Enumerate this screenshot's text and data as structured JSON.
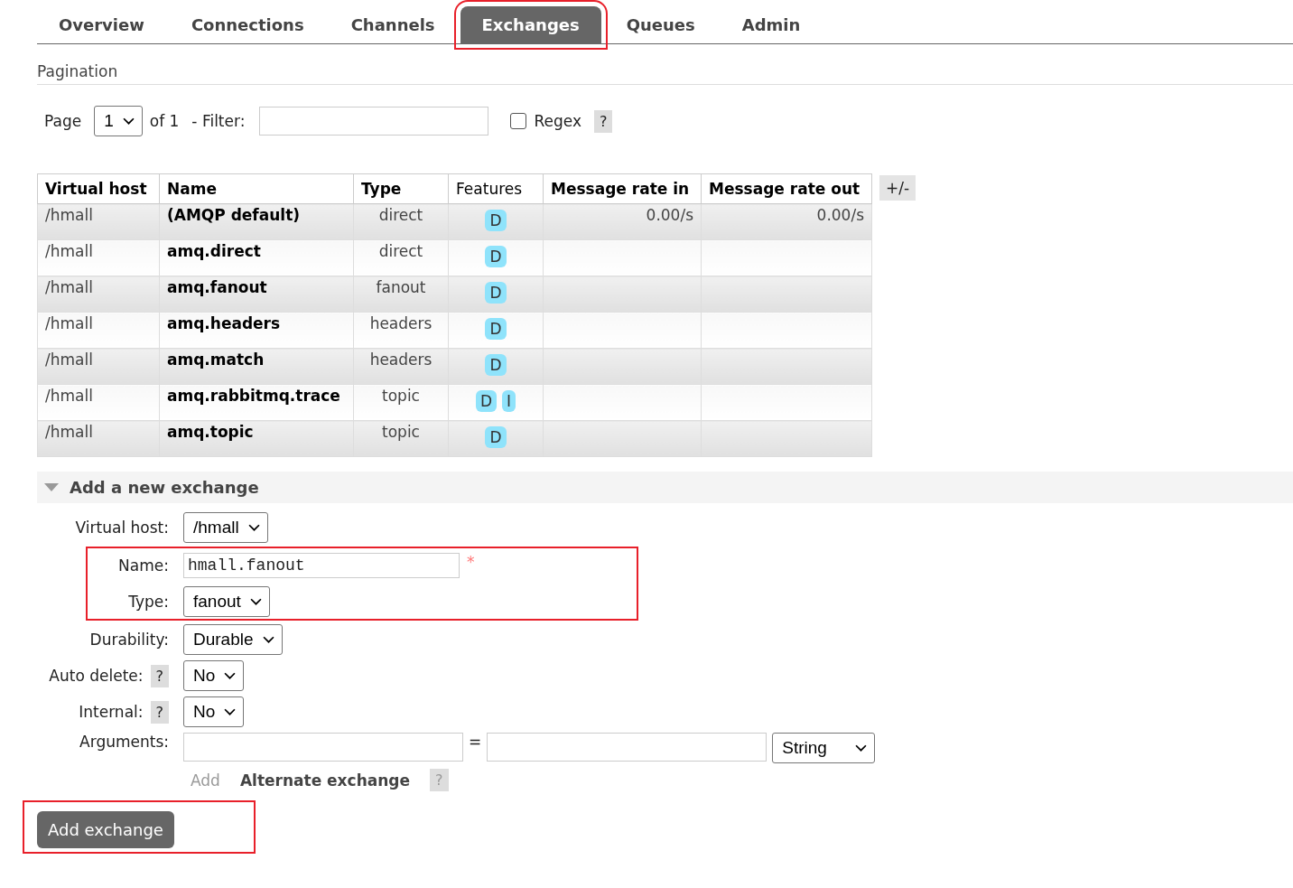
{
  "tabs": [
    {
      "label": "Overview",
      "selected": false,
      "highlighted": false
    },
    {
      "label": "Connections",
      "selected": false,
      "highlighted": false
    },
    {
      "label": "Channels",
      "selected": false,
      "highlighted": false
    },
    {
      "label": "Exchanges",
      "selected": true,
      "highlighted": true
    },
    {
      "label": "Queues",
      "selected": false,
      "highlighted": false
    },
    {
      "label": "Admin",
      "selected": false,
      "highlighted": false
    }
  ],
  "pagination": {
    "title": "Pagination",
    "page_label": "Page",
    "page_value": "1",
    "of_label": "of 1",
    "filter_label": "- Filter:",
    "regex_checked": false,
    "regex_label": "Regex",
    "help": "?"
  },
  "table": {
    "columns": [
      {
        "label": "Virtual host",
        "bold": true
      },
      {
        "label": "Name",
        "bold": true
      },
      {
        "label": "Type",
        "bold": true
      },
      {
        "label": "Features",
        "bold": false
      },
      {
        "label": "Message rate in",
        "bold": true
      },
      {
        "label": "Message rate out",
        "bold": true
      }
    ],
    "toggle": "+/-",
    "rows": [
      {
        "vhost": "/hmall",
        "name": "(AMQP default)",
        "type": "direct",
        "features": [
          "D"
        ],
        "rate_in": "0.00/s",
        "rate_out": "0.00/s"
      },
      {
        "vhost": "/hmall",
        "name": "amq.direct",
        "type": "direct",
        "features": [
          "D"
        ]
      },
      {
        "vhost": "/hmall",
        "name": "amq.fanout",
        "type": "fanout",
        "features": [
          "D"
        ]
      },
      {
        "vhost": "/hmall",
        "name": "amq.headers",
        "type": "headers",
        "features": [
          "D"
        ]
      },
      {
        "vhost": "/hmall",
        "name": "amq.match",
        "type": "headers",
        "features": [
          "D"
        ]
      },
      {
        "vhost": "/hmall",
        "name": "amq.rabbitmq.trace",
        "type": "topic",
        "features": [
          "D",
          "I"
        ]
      },
      {
        "vhost": "/hmall",
        "name": "amq.topic",
        "type": "topic",
        "features": [
          "D"
        ]
      }
    ]
  },
  "add_exchange": {
    "title": "Add a new exchange",
    "expanded": true,
    "groups": [
      {
        "fields": [
          {
            "kind": "select",
            "label": "Virtual host:",
            "value": "/hmall"
          }
        ]
      },
      {
        "highlighted": true,
        "fields": [
          {
            "kind": "text",
            "label": "Name:",
            "value": "hmall.fanout",
            "required": "*"
          },
          {
            "kind": "select",
            "label": "Type:",
            "value": "fanout"
          }
        ]
      },
      {
        "fields": [
          {
            "kind": "select",
            "label": "Durability:",
            "value": "Durable"
          },
          {
            "kind": "select",
            "label": "Auto delete:",
            "help": "?",
            "value": "No"
          },
          {
            "kind": "select",
            "label": "Internal:",
            "help": "?",
            "value": "No"
          },
          {
            "kind": "arguments",
            "label": "Arguments:",
            "equals": "=",
            "arg_type": "String",
            "add_label": "Add",
            "alt_label": "Alternate exchange",
            "alt_help": "?"
          }
        ]
      }
    ],
    "submit": {
      "label": "Add exchange",
      "highlighted": true
    }
  }
}
